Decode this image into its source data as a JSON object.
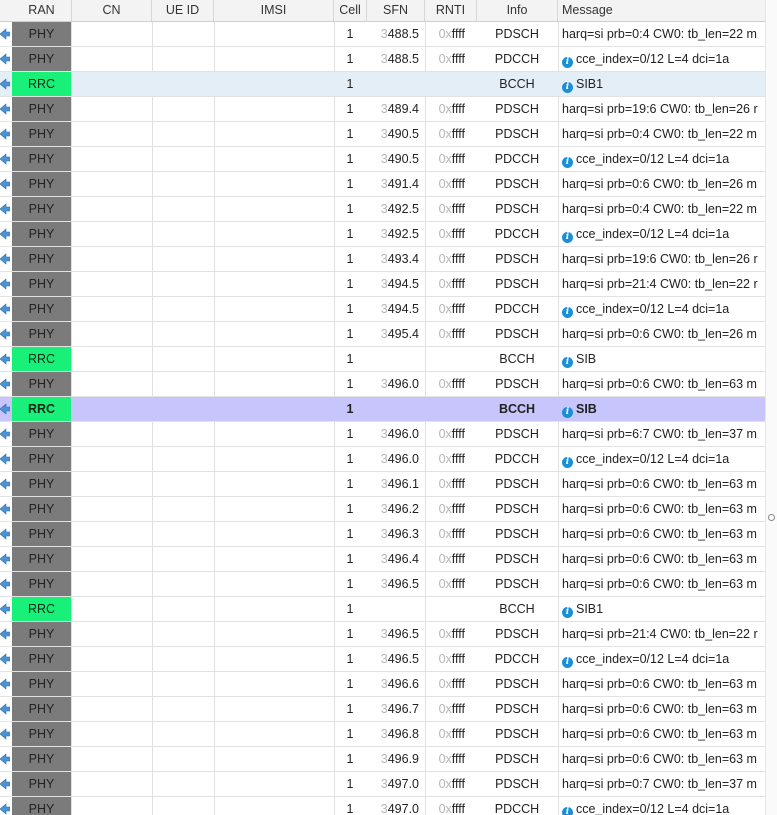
{
  "columns": [
    "RAN",
    "CN",
    "UE ID",
    "IMSI",
    "Cell",
    "SFN",
    "RNTI",
    "Info",
    "Message"
  ],
  "rows": [
    {
      "ran": "PHY",
      "cell": "1",
      "sfn_pre": "3",
      "sfn": "488.5",
      "rnti_pre": "0x",
      "rnti": "ffff",
      "info": "PDSCH",
      "msg": "harq=si prb=0:4 CW0: tb_len=22 m",
      "icon": false,
      "sel": ""
    },
    {
      "ran": "PHY",
      "cell": "1",
      "sfn_pre": "3",
      "sfn": "488.5",
      "rnti_pre": "0x",
      "rnti": "ffff",
      "info": "PDCCH",
      "msg": "cce_index=0/12 L=4 dci=1a",
      "icon": true,
      "sel": ""
    },
    {
      "ran": "RRC",
      "cell": "1",
      "sfn_pre": "",
      "sfn": "",
      "rnti_pre": "",
      "rnti": "",
      "info": "BCCH",
      "msg": "SIB1",
      "icon": true,
      "sel": "light"
    },
    {
      "ran": "PHY",
      "cell": "1",
      "sfn_pre": "3",
      "sfn": "489.4",
      "rnti_pre": "0x",
      "rnti": "ffff",
      "info": "PDSCH",
      "msg": "harq=si prb=19:6 CW0: tb_len=26 r",
      "icon": false,
      "sel": ""
    },
    {
      "ran": "PHY",
      "cell": "1",
      "sfn_pre": "3",
      "sfn": "490.5",
      "rnti_pre": "0x",
      "rnti": "ffff",
      "info": "PDSCH",
      "msg": "harq=si prb=0:4 CW0: tb_len=22 m",
      "icon": false,
      "sel": ""
    },
    {
      "ran": "PHY",
      "cell": "1",
      "sfn_pre": "3",
      "sfn": "490.5",
      "rnti_pre": "0x",
      "rnti": "ffff",
      "info": "PDCCH",
      "msg": "cce_index=0/12 L=4 dci=1a",
      "icon": true,
      "sel": ""
    },
    {
      "ran": "PHY",
      "cell": "1",
      "sfn_pre": "3",
      "sfn": "491.4",
      "rnti_pre": "0x",
      "rnti": "ffff",
      "info": "PDSCH",
      "msg": "harq=si prb=0:6 CW0: tb_len=26 m",
      "icon": false,
      "sel": ""
    },
    {
      "ran": "PHY",
      "cell": "1",
      "sfn_pre": "3",
      "sfn": "492.5",
      "rnti_pre": "0x",
      "rnti": "ffff",
      "info": "PDSCH",
      "msg": "harq=si prb=0:4 CW0: tb_len=22 m",
      "icon": false,
      "sel": ""
    },
    {
      "ran": "PHY",
      "cell": "1",
      "sfn_pre": "3",
      "sfn": "492.5",
      "rnti_pre": "0x",
      "rnti": "ffff",
      "info": "PDCCH",
      "msg": "cce_index=0/12 L=4 dci=1a",
      "icon": true,
      "sel": ""
    },
    {
      "ran": "PHY",
      "cell": "1",
      "sfn_pre": "3",
      "sfn": "493.4",
      "rnti_pre": "0x",
      "rnti": "ffff",
      "info": "PDSCH",
      "msg": "harq=si prb=19:6 CW0: tb_len=26 r",
      "icon": false,
      "sel": ""
    },
    {
      "ran": "PHY",
      "cell": "1",
      "sfn_pre": "3",
      "sfn": "494.5",
      "rnti_pre": "0x",
      "rnti": "ffff",
      "info": "PDSCH",
      "msg": "harq=si prb=21:4 CW0: tb_len=22 r",
      "icon": false,
      "sel": ""
    },
    {
      "ran": "PHY",
      "cell": "1",
      "sfn_pre": "3",
      "sfn": "494.5",
      "rnti_pre": "0x",
      "rnti": "ffff",
      "info": "PDCCH",
      "msg": "cce_index=0/12 L=4 dci=1a",
      "icon": true,
      "sel": ""
    },
    {
      "ran": "PHY",
      "cell": "1",
      "sfn_pre": "3",
      "sfn": "495.4",
      "rnti_pre": "0x",
      "rnti": "ffff",
      "info": "PDSCH",
      "msg": "harq=si prb=0:6 CW0: tb_len=26 m",
      "icon": false,
      "sel": ""
    },
    {
      "ran": "RRC",
      "cell": "1",
      "sfn_pre": "",
      "sfn": "",
      "rnti_pre": "",
      "rnti": "",
      "info": "BCCH",
      "msg": "SIB",
      "icon": true,
      "sel": ""
    },
    {
      "ran": "PHY",
      "cell": "1",
      "sfn_pre": "3",
      "sfn": "496.0",
      "rnti_pre": "0x",
      "rnti": "ffff",
      "info": "PDSCH",
      "msg": "harq=si prb=0:6 CW0: tb_len=63 m",
      "icon": false,
      "sel": ""
    },
    {
      "ran": "RRC",
      "cell": "1",
      "sfn_pre": "",
      "sfn": "",
      "rnti_pre": "",
      "rnti": "",
      "info": "BCCH",
      "msg": "SIB",
      "icon": true,
      "sel": "strong"
    },
    {
      "ran": "PHY",
      "cell": "1",
      "sfn_pre": "3",
      "sfn": "496.0",
      "rnti_pre": "0x",
      "rnti": "ffff",
      "info": "PDSCH",
      "msg": "harq=si prb=6:7 CW0: tb_len=37 m",
      "icon": false,
      "sel": ""
    },
    {
      "ran": "PHY",
      "cell": "1",
      "sfn_pre": "3",
      "sfn": "496.0",
      "rnti_pre": "0x",
      "rnti": "ffff",
      "info": "PDCCH",
      "msg": "cce_index=0/12 L=4 dci=1a",
      "icon": true,
      "sel": ""
    },
    {
      "ran": "PHY",
      "cell": "1",
      "sfn_pre": "3",
      "sfn": "496.1",
      "rnti_pre": "0x",
      "rnti": "ffff",
      "info": "PDSCH",
      "msg": "harq=si prb=0:6 CW0: tb_len=63 m",
      "icon": false,
      "sel": ""
    },
    {
      "ran": "PHY",
      "cell": "1",
      "sfn_pre": "3",
      "sfn": "496.2",
      "rnti_pre": "0x",
      "rnti": "ffff",
      "info": "PDSCH",
      "msg": "harq=si prb=0:6 CW0: tb_len=63 m",
      "icon": false,
      "sel": ""
    },
    {
      "ran": "PHY",
      "cell": "1",
      "sfn_pre": "3",
      "sfn": "496.3",
      "rnti_pre": "0x",
      "rnti": "ffff",
      "info": "PDSCH",
      "msg": "harq=si prb=0:6 CW0: tb_len=63 m",
      "icon": false,
      "sel": ""
    },
    {
      "ran": "PHY",
      "cell": "1",
      "sfn_pre": "3",
      "sfn": "496.4",
      "rnti_pre": "0x",
      "rnti": "ffff",
      "info": "PDSCH",
      "msg": "harq=si prb=0:6 CW0: tb_len=63 m",
      "icon": false,
      "sel": ""
    },
    {
      "ran": "PHY",
      "cell": "1",
      "sfn_pre": "3",
      "sfn": "496.5",
      "rnti_pre": "0x",
      "rnti": "ffff",
      "info": "PDSCH",
      "msg": "harq=si prb=0:6 CW0: tb_len=63 m",
      "icon": false,
      "sel": ""
    },
    {
      "ran": "RRC",
      "cell": "1",
      "sfn_pre": "",
      "sfn": "",
      "rnti_pre": "",
      "rnti": "",
      "info": "BCCH",
      "msg": "SIB1",
      "icon": true,
      "sel": ""
    },
    {
      "ran": "PHY",
      "cell": "1",
      "sfn_pre": "3",
      "sfn": "496.5",
      "rnti_pre": "0x",
      "rnti": "ffff",
      "info": "PDSCH",
      "msg": "harq=si prb=21:4 CW0: tb_len=22 r",
      "icon": false,
      "sel": ""
    },
    {
      "ran": "PHY",
      "cell": "1",
      "sfn_pre": "3",
      "sfn": "496.5",
      "rnti_pre": "0x",
      "rnti": "ffff",
      "info": "PDCCH",
      "msg": "cce_index=0/12 L=4 dci=1a",
      "icon": true,
      "sel": ""
    },
    {
      "ran": "PHY",
      "cell": "1",
      "sfn_pre": "3",
      "sfn": "496.6",
      "rnti_pre": "0x",
      "rnti": "ffff",
      "info": "PDSCH",
      "msg": "harq=si prb=0:6 CW0: tb_len=63 m",
      "icon": false,
      "sel": ""
    },
    {
      "ran": "PHY",
      "cell": "1",
      "sfn_pre": "3",
      "sfn": "496.7",
      "rnti_pre": "0x",
      "rnti": "ffff",
      "info": "PDSCH",
      "msg": "harq=si prb=0:6 CW0: tb_len=63 m",
      "icon": false,
      "sel": ""
    },
    {
      "ran": "PHY",
      "cell": "1",
      "sfn_pre": "3",
      "sfn": "496.8",
      "rnti_pre": "0x",
      "rnti": "ffff",
      "info": "PDSCH",
      "msg": "harq=si prb=0:6 CW0: tb_len=63 m",
      "icon": false,
      "sel": ""
    },
    {
      "ran": "PHY",
      "cell": "1",
      "sfn_pre": "3",
      "sfn": "496.9",
      "rnti_pre": "0x",
      "rnti": "ffff",
      "info": "PDSCH",
      "msg": "harq=si prb=0:6 CW0: tb_len=63 m",
      "icon": false,
      "sel": ""
    },
    {
      "ran": "PHY",
      "cell": "1",
      "sfn_pre": "3",
      "sfn": "497.0",
      "rnti_pre": "0x",
      "rnti": "ffff",
      "info": "PDSCH",
      "msg": "harq=si prb=0:7 CW0: tb_len=37 m",
      "icon": false,
      "sel": ""
    },
    {
      "ran": "PHY",
      "cell": "1",
      "sfn_pre": "3",
      "sfn": "497.0",
      "rnti_pre": "0x",
      "rnti": "ffff",
      "info": "PDCCH",
      "msg": "cce_index=0/12 L=4 dci=1a",
      "icon": true,
      "sel": ""
    }
  ],
  "icons": {
    "row_arrow": "arrow-left-icon",
    "message_info": "info-icon"
  },
  "colors": {
    "phy": "#7b7b7b",
    "rrc": "#19f07a",
    "selected_strong": "#c7c5fc",
    "selected_light": "#e4eef7",
    "info_icon": "#1a8fd6"
  }
}
